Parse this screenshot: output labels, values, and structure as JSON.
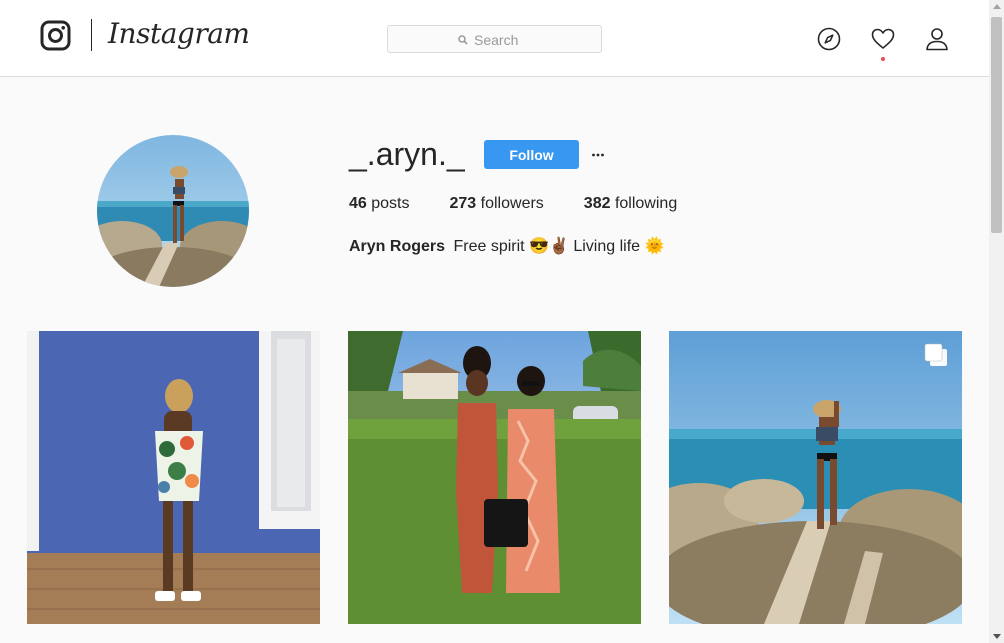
{
  "header": {
    "wordmark": "Instagram",
    "search_placeholder": "Search"
  },
  "profile": {
    "username": "_.aryn._",
    "follow_label": "Follow",
    "more_label": "···",
    "stats": {
      "posts_count": "46",
      "posts_label": "posts",
      "followers_count": "273",
      "followers_label": "followers",
      "following_count": "382",
      "following_label": "following"
    },
    "full_name": "Aryn Rogers",
    "bio": "Free spirit 😎✌🏾 Living life 🌞"
  },
  "icons": {
    "logo": "instagram-camera-icon",
    "search": "search-icon",
    "explore": "compass-icon",
    "activity": "heart-icon",
    "profile": "user-icon",
    "more": "ellipsis-icon",
    "multi": "multiple-photos-icon"
  },
  "colors": {
    "accent": "#3897f0",
    "notification": "#ed4956",
    "border": "#dbdbdb",
    "background": "#fafafa"
  }
}
